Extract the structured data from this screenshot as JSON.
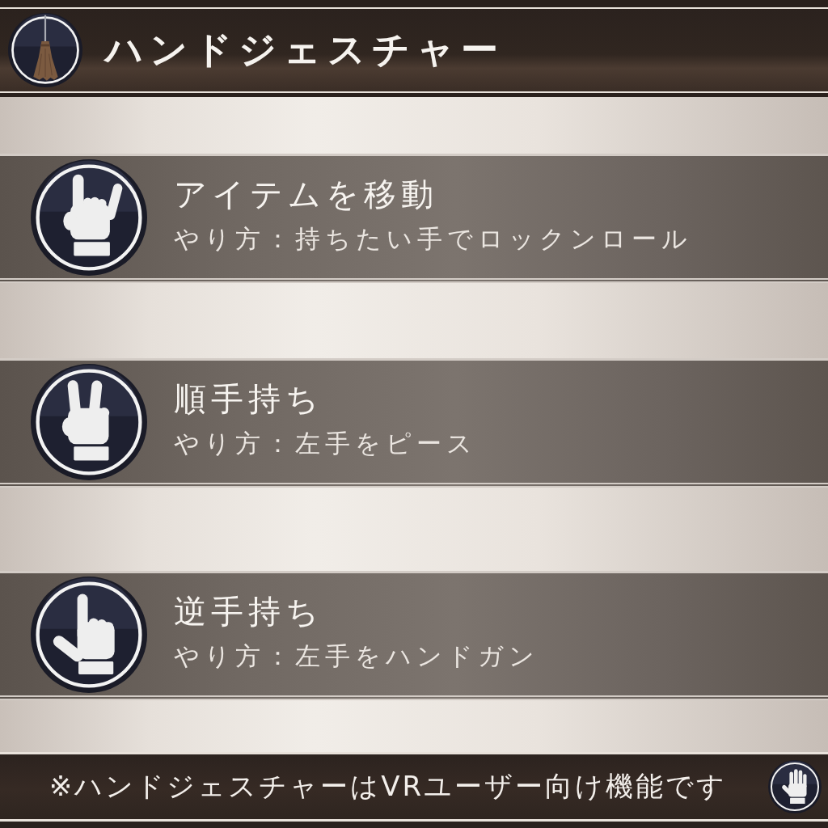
{
  "header": {
    "title": "ハンドジェスチャー"
  },
  "gestures": [
    {
      "kind": "horns",
      "title": "アイテムを移動",
      "instruction": "やり方：持ちたい手でロックンロール"
    },
    {
      "kind": "peace",
      "title": "順手持ち",
      "instruction": "やり方：左手をピース"
    },
    {
      "kind": "point",
      "title": "逆手持ち",
      "instruction": "やり方：左手をハンドガン"
    }
  ],
  "footer": {
    "note": "※ハンドジェスチャーはVRユーザー向け機能です"
  }
}
